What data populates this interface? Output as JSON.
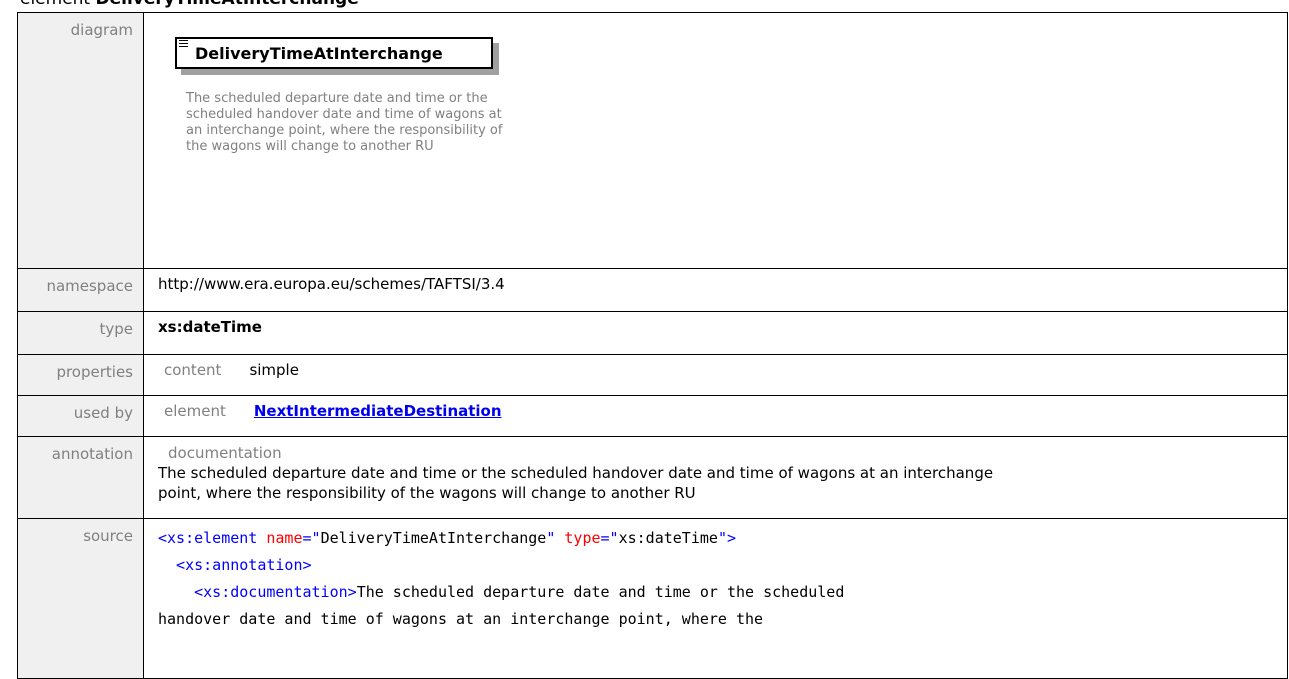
{
  "heading": {
    "prefix": "element",
    "name": "DeliveryTimeAtInterchange"
  },
  "labels": {
    "diagram": "diagram",
    "namespace": "namespace",
    "type": "type",
    "properties": "properties",
    "used_by": "used by",
    "annotation": "annotation",
    "source": "source"
  },
  "diagram": {
    "element_name": "DeliveryTimeAtInterchange",
    "doc": "The scheduled departure date and time or the scheduled handover date and time of wagons at an interchange point, where the responsibility of the wagons will change to another RU"
  },
  "namespace": "http://www.era.europa.eu/schemes/TAFTSI/3.4",
  "type": "xs:dateTime",
  "properties": {
    "key": "content",
    "value": "simple"
  },
  "used_by": {
    "kind": "element",
    "link": "NextIntermediateDestination"
  },
  "annotation": {
    "title": "documentation",
    "line1": "The scheduled departure date and time or the scheduled handover date and time of wagons at an interchange",
    "line2": "point, where the responsibility of the wagons will change to another RU"
  },
  "source": {
    "l1_open": "<xs:element ",
    "l1_attr1": "name",
    "l1_eq1": "=\"",
    "l1_val1": "DeliveryTimeAtInterchange",
    "l1_q1": "\" ",
    "l1_attr2": "type",
    "l1_eq2": "=\"",
    "l1_val2": "xs:dateTime",
    "l1_close": "\">",
    "l2": "  <xs:annotation>",
    "l3_tag": "    <xs:documentation>",
    "l3_text": "The scheduled departure date and time or the scheduled",
    "l4": "handover date and time of wagons at an interchange point, where the"
  }
}
